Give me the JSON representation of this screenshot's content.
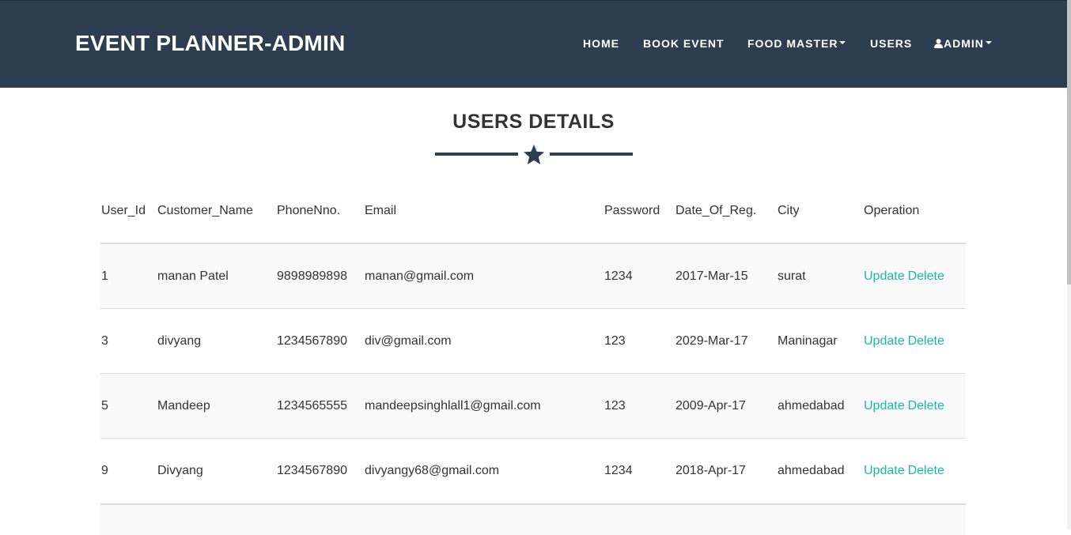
{
  "navbar": {
    "brand": "EVENT PLANNER-ADMIN",
    "items": [
      {
        "label": "HOME",
        "dropdown": false
      },
      {
        "label": "BOOK EVENT",
        "dropdown": false
      },
      {
        "label": "FOOD MASTER",
        "dropdown": true
      },
      {
        "label": "USERS",
        "dropdown": false
      },
      {
        "label": "ADMIN",
        "dropdown": true,
        "icon": "user-icon"
      }
    ],
    "color": "#2c3e50"
  },
  "page": {
    "title": "USERS DETAILS",
    "divider_icon": "star-icon",
    "accent": "#18bc9c"
  },
  "table": {
    "columns": [
      "User_Id",
      "Customer_Name",
      "PhoneNno.",
      "Email",
      "Password",
      "Date_Of_Reg.",
      "City",
      "Operation"
    ],
    "operations": {
      "update": "Update",
      "delete": "Delete"
    },
    "rows": [
      {
        "id": "1",
        "name": "manan Patel",
        "phone": "9898989898",
        "email": "manan@gmail.com",
        "password": "1234",
        "date": "2017-Mar-15",
        "city": "surat"
      },
      {
        "id": "3",
        "name": "divyang",
        "phone": "1234567890",
        "email": "div@gmail.com",
        "password": "123",
        "date": "2029-Mar-17",
        "city": "Maninagar"
      },
      {
        "id": "5",
        "name": "Mandeep",
        "phone": "1234565555",
        "email": "mandeepsinghlall1@gmail.com",
        "password": "123",
        "date": "2009-Apr-17",
        "city": "ahmedabad"
      },
      {
        "id": "9",
        "name": "Divyang",
        "phone": "1234567890",
        "email": "divyangy68@gmail.com",
        "password": "1234",
        "date": "2018-Apr-17",
        "city": "ahmedabad"
      }
    ]
  }
}
